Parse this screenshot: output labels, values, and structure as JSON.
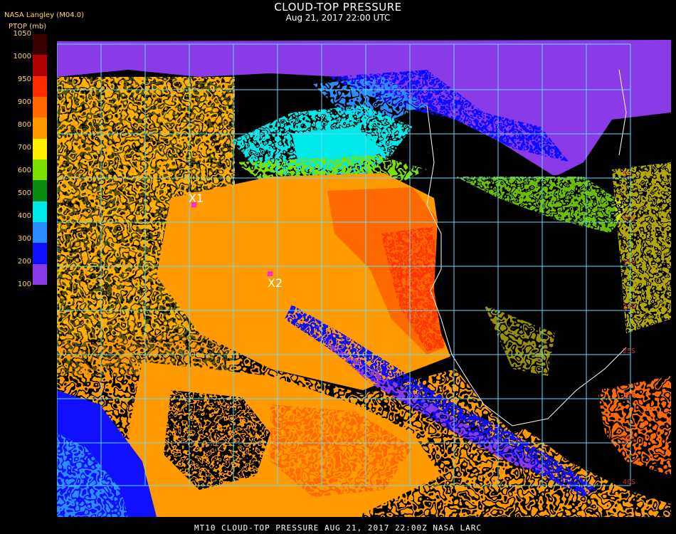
{
  "header": {
    "title": "CLOUD-TOP PRESSURE",
    "subtitle": "Aug 21, 2017 22:00 UTC",
    "source": "NASA Langley (M04.0)",
    "units": "PTOP (mb)"
  },
  "legend": {
    "ticks": [
      "1050",
      "1000",
      "950",
      "900",
      "800",
      "700",
      "600",
      "500",
      "400",
      "300",
      "200",
      "100"
    ],
    "colors": [
      "#3a0000",
      "#b00000",
      "#ff2a00",
      "#ff6a00",
      "#ff9a00",
      "#ffee00",
      "#7be000",
      "#0b8a12",
      "#00e8e8",
      "#2a8cff",
      "#1010ff",
      "#8a3ae6"
    ]
  },
  "map": {
    "lat_labels": [
      "5S",
      "10S",
      "15S",
      "20S",
      "25S",
      "30S",
      "35S",
      "40S"
    ],
    "markers": [
      {
        "label": "X1",
        "color": "#ff2ad6"
      },
      {
        "label": "X2",
        "color": "#ff2ad6"
      }
    ]
  },
  "footer": {
    "text": "MT10  CLOUD-TOP PRESSURE   AUG 21, 2017 22:00Z   NASA LARC"
  }
}
